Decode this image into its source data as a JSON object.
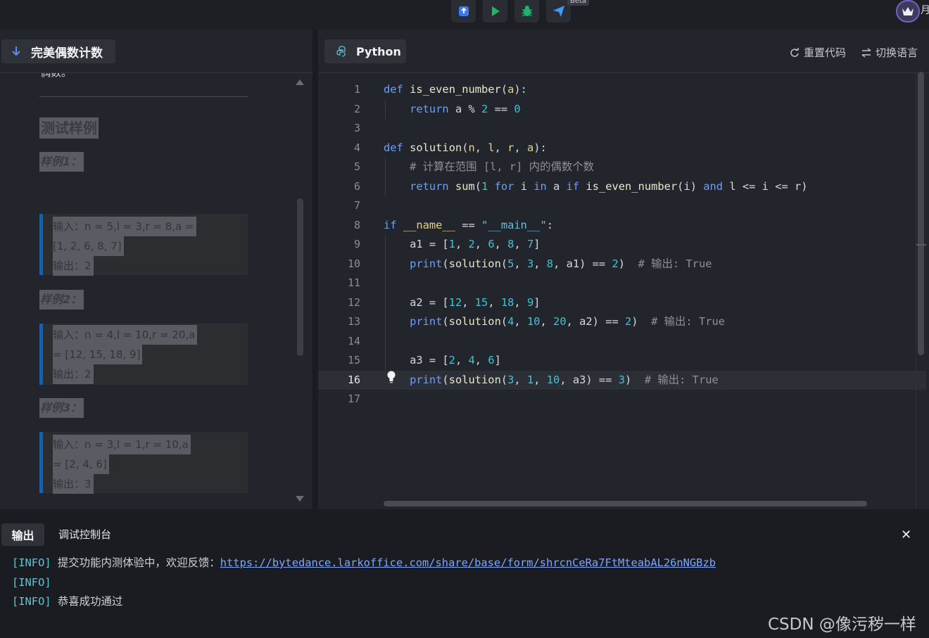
{
  "toolbar": {
    "buttons": [
      {
        "name": "submit",
        "icon": "submit-icon",
        "color": "#3a7bf5"
      },
      {
        "name": "run",
        "icon": "play-icon",
        "color": "#20b36a"
      },
      {
        "name": "debug",
        "icon": "bug-icon",
        "color": "#20b36a"
      },
      {
        "name": "send",
        "icon": "send-icon",
        "color": "#3a9cf5"
      }
    ],
    "beta_label": "Beta",
    "user_name_partial": "月"
  },
  "problem": {
    "title": "完美偶数计数",
    "partial_text": "偶数。",
    "test_heading": "测试样例",
    "examples": [
      {
        "label": "样例1：",
        "lines": [
          "输入：n = 5,l = 3,r = 8,a =",
          "[1, 2, 6, 8, 7]",
          "输出：2"
        ]
      },
      {
        "label": "样例2：",
        "lines": [
          "输入：n = 4,l = 10,r = 20,a",
          "= [12, 15, 18, 9]",
          "输出：2"
        ]
      },
      {
        "label": "样例3：",
        "lines": [
          "输入：n = 3,l = 1,r = 10,a",
          "= [2, 4, 6]",
          "输出：3"
        ]
      }
    ]
  },
  "editor": {
    "language": "Python",
    "reset_label": "重置代码",
    "switch_label": "切换语言",
    "current_line": 16,
    "line_numbers": [
      "1",
      "2",
      "3",
      "4",
      "5",
      "6",
      "7",
      "8",
      "9",
      "10",
      "11",
      "12",
      "13",
      "14",
      "15",
      "16",
      "17"
    ],
    "comments": {
      "line5": "# 计算在范围 [l, r] 内的偶数个数",
      "line10": "# 输出: True",
      "line13": "# 输出: True",
      "line16": "# 输出: True"
    }
  },
  "output": {
    "tab_output": "输出",
    "tab_debug": "调试控制台",
    "logs": [
      {
        "tag": "[INFO]",
        "text": "提交功能内测体验中，欢迎反馈：",
        "link": "https://bytedance.larkoffice.com/share/base/form/shrcnCeRa7FtMteabAL26nNGBzb"
      },
      {
        "tag": "[INFO]",
        "text": "",
        "link": ""
      },
      {
        "tag": "[INFO]",
        "text": "恭喜成功通过",
        "link": ""
      }
    ]
  },
  "watermark": "CSDN @像污秽一样"
}
